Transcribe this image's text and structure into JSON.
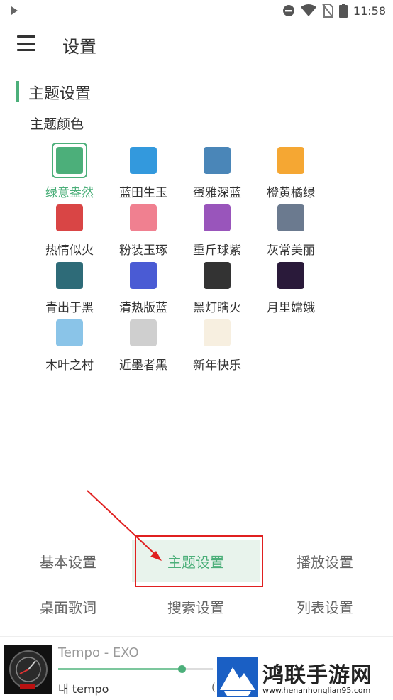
{
  "status_bar": {
    "time": "11:58",
    "icons": [
      "play-icon",
      "do-not-disturb-icon",
      "wifi-icon",
      "no-sim-icon",
      "battery-icon"
    ]
  },
  "appbar": {
    "title": "设置"
  },
  "section": {
    "title": "主题设置",
    "subtitle": "主题颜色",
    "accent": "#4caf7a"
  },
  "themes": [
    {
      "label": "绿意盎然",
      "color": "#4caf7a",
      "selected": true
    },
    {
      "label": "蓝田生玉",
      "color": "#3399dd"
    },
    {
      "label": "蛋雅深蓝",
      "color": "#4a86b8"
    },
    {
      "label": "橙黄橘绿",
      "color": "#f5a733"
    },
    {
      "label": "热情似火",
      "color": "#d94545"
    },
    {
      "label": "粉装玉琢",
      "color": "#f08090"
    },
    {
      "label": "重斤球紫",
      "color": "#9955bb"
    },
    {
      "label": "灰常美丽",
      "color": "#6b7a8f"
    },
    {
      "label": "青出于黑",
      "color": "#2e6b78"
    },
    {
      "label": "清热版蓝",
      "color": "#4a5bd4"
    },
    {
      "label": "黑灯瞎火",
      "color": "#333333"
    },
    {
      "label": "月里嫦娥",
      "color": "#2a1a3a"
    },
    {
      "label": "木叶之村",
      "color": "#8ac4e8"
    },
    {
      "label": "近墨者黑",
      "color": "#cfcfcf"
    },
    {
      "label": "新年快乐",
      "color": "#f7efe0"
    }
  ],
  "tabs": [
    {
      "label": "基本设置"
    },
    {
      "label": "主题设置",
      "active": true
    },
    {
      "label": "播放设置"
    },
    {
      "label": "桌面歌词"
    },
    {
      "label": "搜索设置"
    },
    {
      "label": "列表设置"
    }
  ],
  "player": {
    "title": "Tempo - EXO",
    "lyric": "내 tempo",
    "time_partial": "(",
    "progress": 0.8
  },
  "watermark": {
    "title": "鸿联手游网",
    "url": "www.henanhonglian95.com"
  }
}
